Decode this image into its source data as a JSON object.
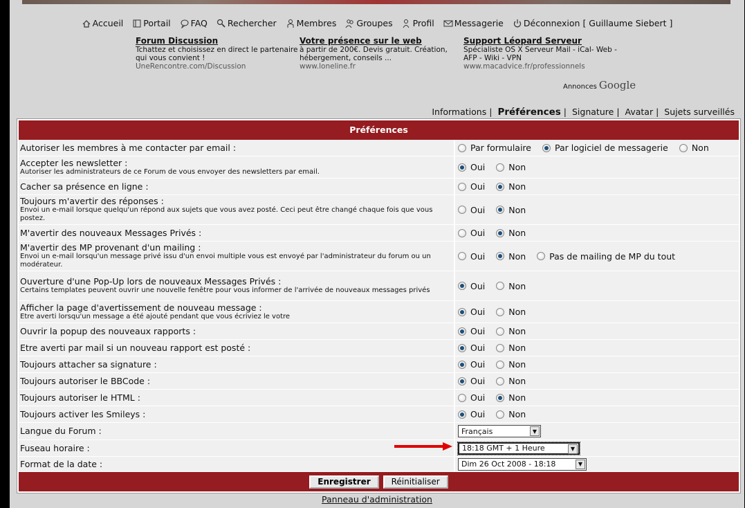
{
  "nav": [
    {
      "label": "Accueil",
      "icon": "home-icon"
    },
    {
      "label": "Portail",
      "icon": "portal-icon"
    },
    {
      "label": "FAQ",
      "icon": "faq-icon"
    },
    {
      "label": "Rechercher",
      "icon": "search-icon"
    },
    {
      "label": "Membres",
      "icon": "members-icon"
    },
    {
      "label": "Groupes",
      "icon": "groups-icon"
    },
    {
      "label": "Profil",
      "icon": "profile-icon"
    },
    {
      "label": "Messagerie",
      "icon": "mail-icon"
    },
    {
      "label": "Déconnexion [ Guillaume Siebert ]",
      "icon": "power-icon"
    }
  ],
  "ads": [
    {
      "title": "Forum Discussion",
      "desc": "Tchattez et choisissez en direct le partenaire qui vous convient !",
      "url": "UneRencontre.com/Discussion"
    },
    {
      "title": "Votre présence sur le web",
      "desc": "à partir de 200€. Devis gratuit. Création, hébergement, conseils ...",
      "url": "www.loneline.fr"
    },
    {
      "title": "Support Léopard Serveur",
      "desc": "Spécialiste OS X Serveur Mail - iCal- Web - AFP - Wiki - VPN",
      "url": "www.macadvice.fr/professionnels"
    }
  ],
  "google": {
    "prefix": "Annonces",
    "brand": "Google"
  },
  "subnav": {
    "info": "Informations",
    "prefs": "Préférences",
    "sig": "Signature",
    "avatar": "Avatar",
    "watched": "Sujets surveillés"
  },
  "table": {
    "title": "Préférences"
  },
  "rows": [
    {
      "label": "Autoriser les membres à me contacter par email :",
      "sub": "",
      "options": [
        "Par formulaire",
        "Par logiciel de messagerie",
        "Non"
      ],
      "selected": 1
    },
    {
      "label": "Accepter les newsletter :",
      "sub": "Autoriser les administrateurs de ce Forum de vous envoyer des newsletters par email.",
      "options": [
        "Oui",
        "Non"
      ],
      "selected": 0
    },
    {
      "label": "Cacher sa présence en ligne :",
      "sub": "",
      "options": [
        "Oui",
        "Non"
      ],
      "selected": 1
    },
    {
      "label": "Toujours m'avertir des réponses :",
      "sub": "Envoi un e-mail lorsque quelqu'un répond aux sujets que vous avez posté. Ceci peut être changé chaque fois que vous postez.",
      "options": [
        "Oui",
        "Non"
      ],
      "selected": 1
    },
    {
      "label": "M'avertir des nouveaux Messages Privés :",
      "sub": "",
      "options": [
        "Oui",
        "Non"
      ],
      "selected": 1
    },
    {
      "label": "M'avertir des MP provenant d'un mailing :",
      "sub": "Envoi un e-mail lorsqu'un message privé issu d'un envoi multiple vous est envoyé par l'administrateur du forum ou un modérateur.",
      "options": [
        "Oui",
        "Non",
        "Pas de mailing de MP du tout"
      ],
      "selected": 1
    },
    {
      "label": "Ouverture d'une Pop-Up lors de nouveaux Messages Privés :",
      "sub": "Certains templates peuvent ouvrir une nouvelle fenêtre pour vous informer de l'arrivée de nouveaux messages privés",
      "options": [
        "Oui",
        "Non"
      ],
      "selected": 0
    },
    {
      "label": "Afficher la page d'avertissement de nouveau message :",
      "sub": "Etre averti lorsqu'un message a été ajouté pendant que vous écriviez le votre",
      "options": [
        "Oui",
        "Non"
      ],
      "selected": 0
    },
    {
      "label": "Ouvrir la popup des nouveaux rapports :",
      "sub": "",
      "options": [
        "Oui",
        "Non"
      ],
      "selected": 0
    },
    {
      "label": "Etre averti par mail si un nouveau rapport est posté :",
      "sub": "",
      "options": [
        "Oui",
        "Non"
      ],
      "selected": 0
    },
    {
      "label": "Toujours attacher sa signature :",
      "sub": "",
      "options": [
        "Oui",
        "Non"
      ],
      "selected": 0
    },
    {
      "label": "Toujours autoriser le BBCode :",
      "sub": "",
      "options": [
        "Oui",
        "Non"
      ],
      "selected": 0
    },
    {
      "label": "Toujours autoriser le HTML :",
      "sub": "",
      "options": [
        "Oui",
        "Non"
      ],
      "selected": 1
    },
    {
      "label": "Toujours activer les Smileys :",
      "sub": "",
      "options": [
        "Oui",
        "Non"
      ],
      "selected": 0
    }
  ],
  "selects": [
    {
      "label": "Langue du Forum :",
      "value": "Français"
    },
    {
      "label": "Fuseau horaire :",
      "value": "18:18 GMT + 1 Heure"
    },
    {
      "label": "Format de la date :",
      "value": "Dim 26 Oct 2008 - 18:18"
    }
  ],
  "buttons": {
    "save": "Enregistrer",
    "reset": "Réinitialiser"
  },
  "admin_link": "Panneau d'administration",
  "colors": {
    "header": "#951c20",
    "arrow": "#e00000"
  }
}
